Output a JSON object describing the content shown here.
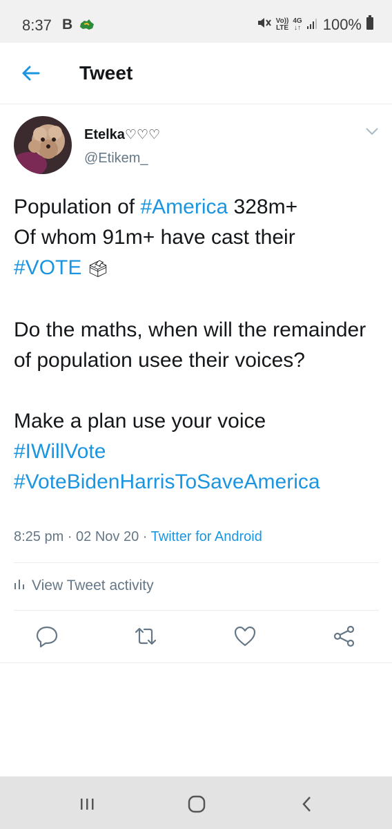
{
  "status_bar": {
    "time": "8:37",
    "notif_letter": "B",
    "volte_top": "Vo))",
    "volte_bottom": "LTE",
    "net_top": "4G",
    "net_bottom": "↓↑",
    "battery": "100%"
  },
  "header": {
    "title": "Tweet"
  },
  "tweet": {
    "name": "Etelka",
    "name_hearts": "♡♡♡",
    "handle": "@Etikem_",
    "line1_text": "Population of ",
    "line1_tag": "#America",
    "line1_rest": " 328m+",
    "line2": "Of whom 91m+ have cast their",
    "line3_tag": "#VOTE",
    "line3_emoji": "🗳",
    "para2": "Do the maths, when will the remainder of population usee their voices?",
    "para3": "Make a plan  use your voice",
    "tag_iwillvote": "#IWillVote",
    "tag_votebiden": "#VoteBidenHarrisToSaveAmerica",
    "time": "8:25 pm",
    "sep1": " · ",
    "date": "02 Nov 20",
    "sep2": " · ",
    "app": "Twitter for Android",
    "activity": "View Tweet activity"
  },
  "colors": {
    "link": "#1b95e0",
    "muted": "#657786",
    "divider": "#e6ecf0"
  },
  "icons": [
    "back-arrow-icon",
    "chevron-down-icon",
    "bar-chart-icon",
    "reply-icon",
    "retweet-icon",
    "like-icon",
    "share-icon",
    "recent-apps-icon",
    "home-icon",
    "nav-back-icon"
  ]
}
